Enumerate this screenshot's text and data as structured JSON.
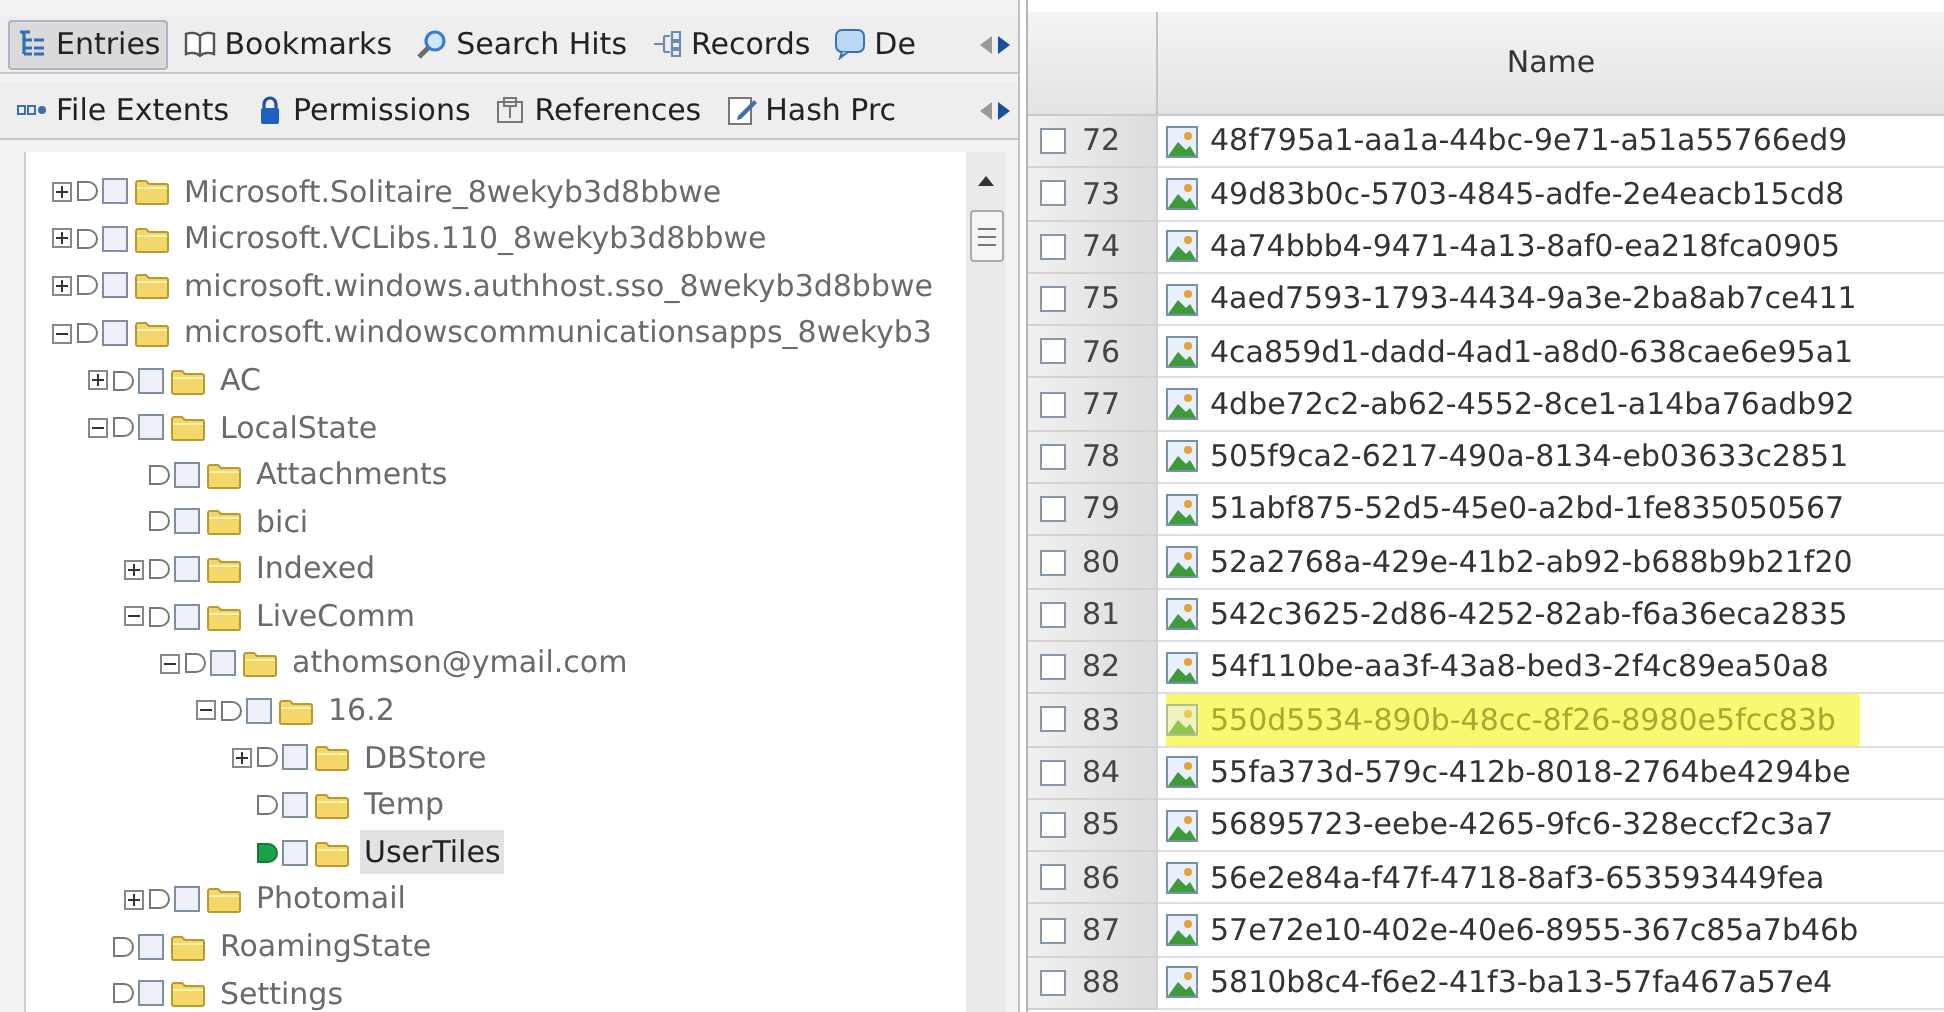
{
  "tabs_primary": [
    {
      "label": "Entries",
      "selected": true
    },
    {
      "label": "Bookmarks",
      "selected": false
    },
    {
      "label": "Search Hits",
      "selected": false
    },
    {
      "label": "Records",
      "selected": false
    },
    {
      "label": "De",
      "selected": false
    }
  ],
  "tabs_secondary": [
    {
      "label": "File Extents",
      "selected": false
    },
    {
      "label": "Permissions",
      "selected": false
    },
    {
      "label": "References",
      "selected": false
    },
    {
      "label": "Hash Prc",
      "selected": false
    }
  ],
  "tree": [
    {
      "label": "Microsoft.Solitaire_8wekyb3d8bbwe",
      "expanded": false,
      "checked": false,
      "selected": false
    },
    {
      "label": "Microsoft.VCLibs.110_8wekyb3d8bbwe",
      "expanded": false,
      "checked": false,
      "selected": false
    },
    {
      "label": "microsoft.windows.authhost.sso_8wekyb3d8bbwe",
      "expanded": false,
      "checked": false,
      "selected": false
    },
    {
      "label": "microsoft.windowscommunicationsapps_8wekyb3",
      "expanded": true,
      "checked": false,
      "selected": false,
      "children": [
        {
          "label": "AC",
          "expanded": false,
          "checked": false,
          "selected": false
        },
        {
          "label": "LocalState",
          "expanded": true,
          "checked": false,
          "selected": false,
          "children": [
            {
              "label": "Attachments",
              "checked": false,
              "selected": false
            },
            {
              "label": "bici",
              "checked": false,
              "selected": false
            },
            {
              "label": "Indexed",
              "expanded": false,
              "checked": false,
              "selected": false
            },
            {
              "label": "LiveComm",
              "expanded": true,
              "checked": false,
              "selected": false,
              "children": [
                {
                  "label": "athomson@ymail.com",
                  "expanded": true,
                  "checked": false,
                  "selected": false,
                  "children": [
                    {
                      "label": "16.2",
                      "expanded": true,
                      "checked": false,
                      "selected": false,
                      "children": [
                        {
                          "label": "DBStore",
                          "expanded": false,
                          "checked": false,
                          "selected": false
                        },
                        {
                          "label": "Temp",
                          "checked": false,
                          "selected": false
                        },
                        {
                          "label": "UserTiles",
                          "checked": false,
                          "selected": true
                        }
                      ]
                    }
                  ]
                }
              ]
            },
            {
              "label": "Photomail",
              "expanded": false,
              "checked": false,
              "selected": false
            }
          ]
        },
        {
          "label": "RoamingState",
          "checked": false,
          "selected": false
        },
        {
          "label": "Settings",
          "checked": false,
          "selected": false
        }
      ]
    }
  ],
  "table": {
    "columns": [
      "Name"
    ],
    "rows": [
      {
        "number": "72",
        "name": "48f795a1-aa1a-44bc-9e71-a51a55766ed9",
        "checked": false,
        "selected": false
      },
      {
        "number": "73",
        "name": "49d83b0c-5703-4845-adfe-2e4eacb15cd8",
        "checked": false,
        "selected": false
      },
      {
        "number": "74",
        "name": "4a74bbb4-9471-4a13-8af0-ea218fca0905",
        "checked": false,
        "selected": false
      },
      {
        "number": "75",
        "name": "4aed7593-1793-4434-9a3e-2ba8ab7ce411",
        "checked": false,
        "selected": false
      },
      {
        "number": "76",
        "name": "4ca859d1-dadd-4ad1-a8d0-638cae6e95a1",
        "checked": false,
        "selected": false
      },
      {
        "number": "77",
        "name": "4dbe72c2-ab62-4552-8ce1-a14ba76adb92",
        "checked": false,
        "selected": false
      },
      {
        "number": "78",
        "name": "505f9ca2-6217-490a-8134-eb03633c2851",
        "checked": false,
        "selected": false
      },
      {
        "number": "79",
        "name": "51abf875-52d5-45e0-a2bd-1fe835050567",
        "checked": false,
        "selected": false
      },
      {
        "number": "80",
        "name": "52a2768a-429e-41b2-ab92-b688b9b21f20",
        "checked": false,
        "selected": false
      },
      {
        "number": "81",
        "name": "542c3625-2d86-4252-82ab-f6a36eca2835",
        "checked": false,
        "selected": false
      },
      {
        "number": "82",
        "name": "54f110be-aa3f-43a8-bed3-2f4c89ea50a8",
        "checked": false,
        "selected": false
      },
      {
        "number": "83",
        "name": "550d5534-890b-48cc-8f26-8980e5fcc83b",
        "checked": false,
        "selected": true
      },
      {
        "number": "84",
        "name": "55fa373d-579c-412b-8018-2764be4294be",
        "checked": false,
        "selected": false
      },
      {
        "number": "85",
        "name": "56895723-eebe-4265-9fc6-328eccf2c3a7",
        "checked": false,
        "selected": false
      },
      {
        "number": "86",
        "name": "56e2e84a-f47f-4718-8af3-653593449fea",
        "checked": false,
        "selected": false
      },
      {
        "number": "87",
        "name": "57e72e10-402e-40e6-8955-367c85a7b46b",
        "checked": false,
        "selected": false
      },
      {
        "number": "88",
        "name": "5810b8c4-f6e2-41f3-ba13-57fa467a57e4",
        "checked": false,
        "selected": false
      }
    ]
  }
}
